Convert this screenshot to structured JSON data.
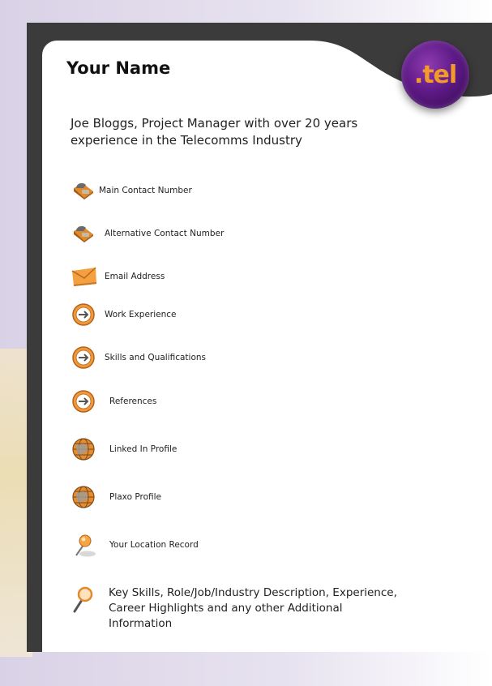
{
  "header": {
    "title": "Your Name",
    "logo_text": ".tel"
  },
  "intro": "Joe Bloggs, Project Manager with over 20 years experience in the Telecomms Industry",
  "items": [
    {
      "label": "Main Contact Number",
      "icon": "phone-icon"
    },
    {
      "label": "Alternative Contact Number",
      "icon": "phone-icon"
    },
    {
      "label": "Email Address",
      "icon": "envelope-icon"
    },
    {
      "label": "Work Experience",
      "icon": "arrow-circle-icon"
    },
    {
      "label": "Skills and Qualifications",
      "icon": "arrow-circle-icon"
    },
    {
      "label": "References",
      "icon": "arrow-circle-icon"
    },
    {
      "label": "Linked In Profile",
      "icon": "globe-icon"
    },
    {
      "label": "Plaxo Profile",
      "icon": "globe-icon"
    },
    {
      "label": "Your Location Record",
      "icon": "location-pin-icon"
    }
  ],
  "footer_text": "Key Skills, Role/Job/Industry Description, Experience, Career Highlights and any other Additional Information",
  "colors": {
    "frame": "#3b3b3b",
    "accent_orange": "#f39a2a",
    "logo_purple": "#5e1a86"
  }
}
